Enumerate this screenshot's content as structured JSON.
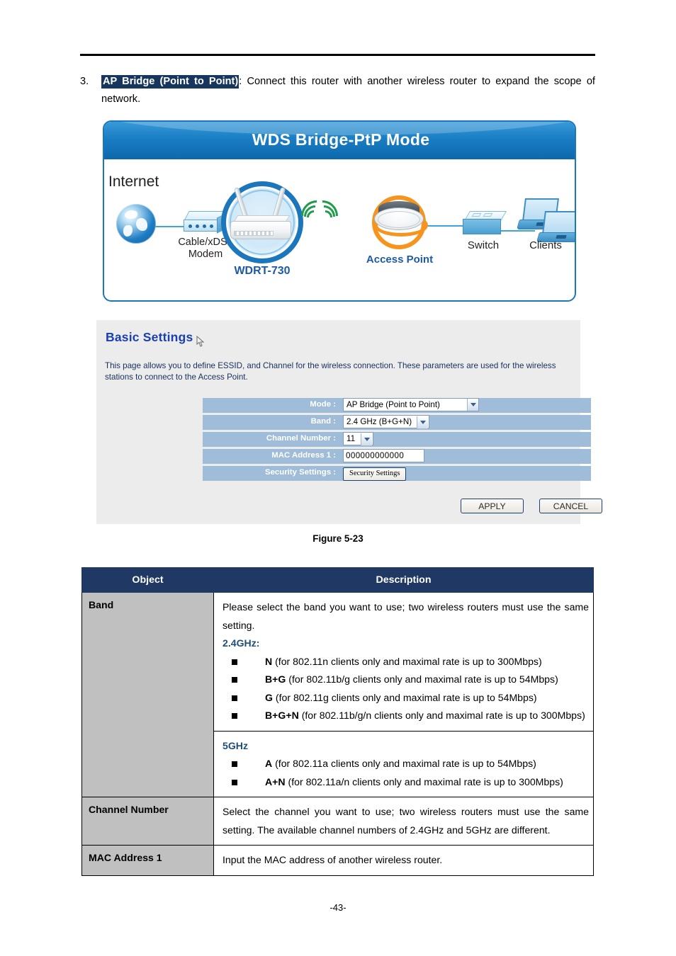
{
  "document": {
    "page_number": "-43-",
    "figure_caption": "Figure 5-23"
  },
  "intro": {
    "number": "3.",
    "highlight": "AP Bridge (Point to Point)",
    "text": ": Connect this router with another wireless router to expand the scope of network."
  },
  "diagram": {
    "title": "WDS Bridge-PtP Mode",
    "nodes": {
      "internet": "Internet",
      "modem": "Cable/xDSL\nModem",
      "router": "WDRT-730",
      "access_point": "Access Point",
      "switch": "Switch",
      "clients": "Clients"
    },
    "colors": {
      "border": "#1b76bc",
      "title_bar": "#1a7ec4",
      "ap_ring": "#f6941e",
      "wifi_arc": "#1e9c4a",
      "link_line": "#3ba5dd"
    }
  },
  "panel": {
    "title": "Basic Settings",
    "description": "This page allows you to define ESSID, and Channel for the wireless connection. These parameters are used for the wireless stations to connect to the Access Point.",
    "fields": [
      {
        "label": "Mode :",
        "type": "select",
        "value": "AP Bridge (Point to Point)"
      },
      {
        "label": "Band :",
        "type": "select",
        "value": "2.4 GHz (B+G+N)"
      },
      {
        "label": "Channel Number :",
        "type": "select",
        "value": "11"
      },
      {
        "label": "MAC Address 1 :",
        "type": "text",
        "value": "000000000000"
      },
      {
        "label": "Security Settings :",
        "type": "button",
        "value": "Security Settings"
      }
    ],
    "buttons": {
      "apply": "APPLY",
      "cancel": "CANCEL"
    },
    "colors": {
      "background": "#ececed",
      "label_cell": "#9fbdd9",
      "title": "#1c39b5",
      "description_text": "#17305a"
    }
  },
  "table": {
    "headers": {
      "object": "Object",
      "description": "Description"
    },
    "header_color": "#1f3864",
    "object_cell_color": "#c0c0c0",
    "rows": [
      {
        "object": "Band",
        "blocks": [
          {
            "paragraph": "Please select the band you want to use; two wireless routers must use the same setting.",
            "sub_head": "2.4GHz:",
            "bullets": [
              {
                "term": "N",
                "rest": "(for 802.11n clients only and maximal rate is up to 300Mbps)"
              },
              {
                "term": "B+G",
                "rest": "(for 802.11b/g clients only and maximal rate is up to 54Mbps)"
              },
              {
                "term": "G",
                "rest": "(for 802.11g clients only and maximal rate is up to 54Mbps)"
              },
              {
                "term": "B+G+N",
                "rest": "(for 802.11b/g/n clients only and maximal rate is up to 300Mbps)"
              }
            ]
          },
          {
            "paragraph": "",
            "sub_head": "5GHz",
            "bullets": [
              {
                "term": "A",
                "rest": "(for 802.11a clients only and maximal rate is up to 54Mbps)"
              },
              {
                "term": "A+N",
                "rest": "(for 802.11a/n clients only and maximal rate is up to 300Mbps)"
              }
            ]
          }
        ]
      },
      {
        "object": "Channel Number",
        "description": "Select the channel you want to use; two wireless routers must use the same setting. The available channel numbers of 2.4GHz and 5GHz are different."
      },
      {
        "object": "MAC Address 1",
        "description": "Input the MAC address of another wireless router."
      }
    ]
  }
}
